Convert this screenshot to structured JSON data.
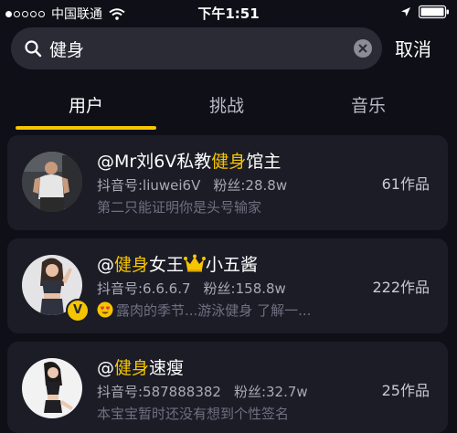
{
  "status_bar": {
    "carrier": "中国联通",
    "time": "下午1:51"
  },
  "search": {
    "query": "健身",
    "cancel_label": "取消"
  },
  "tabs": [
    {
      "label": "用户",
      "active": true
    },
    {
      "label": "挑战",
      "active": false
    },
    {
      "label": "音乐",
      "active": false
    }
  ],
  "results": [
    {
      "name_prefix": "@Mr刘6V私教",
      "name_highlight": "健身",
      "name_suffix": "馆主",
      "douyin_id": "抖音号:liuwei6V",
      "fans": "粉丝:28.8w",
      "description": "第二只能证明你是头号输家",
      "works": "61作品"
    },
    {
      "name_prefix": "@",
      "name_highlight": "健身",
      "name_suffix": "女王",
      "name_tail": "小五酱",
      "douyin_id": "抖音号:6.6.6.7",
      "fans": "粉丝:158.8w",
      "description": "露肉的季节...游泳健身 了解一...",
      "works": "222作品",
      "badge": "V"
    },
    {
      "name_prefix": "@",
      "name_highlight": "健身",
      "name_suffix": "速瘦",
      "douyin_id": "抖音号:587888382",
      "fans": "粉丝:32.7w",
      "description": "本宝宝暂时还没有想到个性签名",
      "works": "25作品"
    }
  ],
  "colors": {
    "highlight": "#f6c500",
    "background": "#0f0f17",
    "card": "#1b1c26"
  }
}
